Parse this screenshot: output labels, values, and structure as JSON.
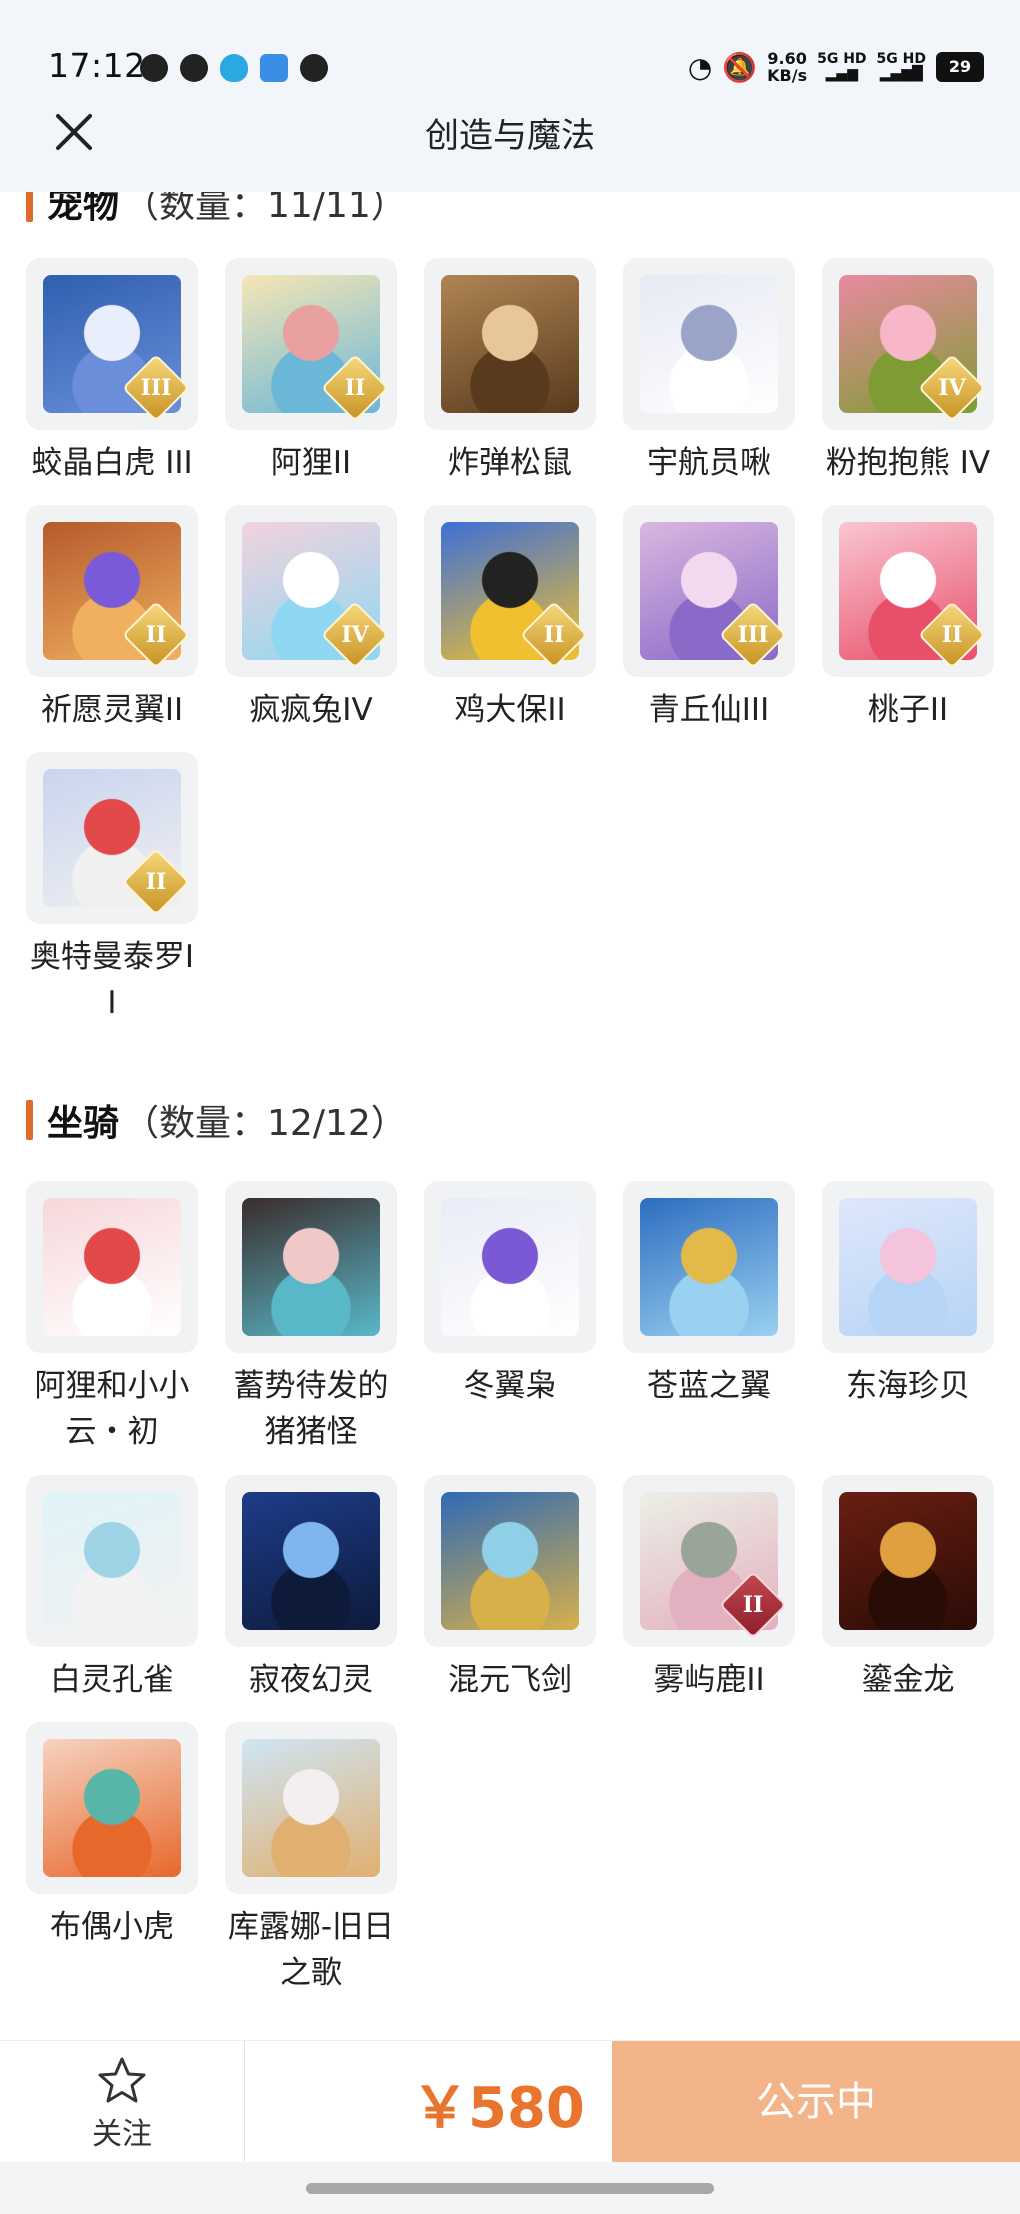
{
  "status_bar": {
    "time": "17:12",
    "net_speed": "9.60",
    "net_unit": "KB/s",
    "sig1": "5G HD",
    "sig2": "5G HD",
    "battery": "29"
  },
  "header": {
    "title": "创造与魔法"
  },
  "pets": {
    "title": "宠物",
    "count": "（数量：11/11）",
    "items": [
      {
        "label": "蛟晶白虎 III",
        "tier": "III",
        "badge": "gold"
      },
      {
        "label": "阿狸II",
        "tier": "II",
        "badge": "gold"
      },
      {
        "label": "炸弹松鼠",
        "tier": "",
        "badge": ""
      },
      {
        "label": "宇航员啾",
        "tier": "",
        "badge": ""
      },
      {
        "label": "粉抱抱熊 IV",
        "tier": "IV",
        "badge": "gold"
      },
      {
        "label": "祈愿灵翼II",
        "tier": "II",
        "badge": "gold"
      },
      {
        "label": "疯疯兔IV",
        "tier": "IV",
        "badge": "gold"
      },
      {
        "label": "鸡大保II",
        "tier": "II",
        "badge": "gold"
      },
      {
        "label": "青丘仙III",
        "tier": "III",
        "badge": "gold"
      },
      {
        "label": "桃子II",
        "tier": "II",
        "badge": "gold"
      },
      {
        "label": "奥特曼泰罗II",
        "tier": "II",
        "badge": "gold"
      }
    ]
  },
  "mounts": {
    "title": "坐骑",
    "count": "（数量：12/12）",
    "items": [
      {
        "label": "阿狸和小小云・初",
        "tier": "",
        "badge": ""
      },
      {
        "label": "蓄势待发的猪猪怪",
        "tier": "",
        "badge": ""
      },
      {
        "label": "冬翼枭",
        "tier": "",
        "badge": ""
      },
      {
        "label": "苍蓝之翼",
        "tier": "",
        "badge": ""
      },
      {
        "label": "东海珍贝",
        "tier": "",
        "badge": ""
      },
      {
        "label": "白灵孔雀",
        "tier": "",
        "badge": ""
      },
      {
        "label": "寂夜幻灵",
        "tier": "",
        "badge": ""
      },
      {
        "label": "混元飞剑",
        "tier": "",
        "badge": ""
      },
      {
        "label": "雾屿鹿II",
        "tier": "II",
        "badge": "red"
      },
      {
        "label": "鎏金龙",
        "tier": "",
        "badge": ""
      },
      {
        "label": "布偶小虎",
        "tier": "",
        "badge": ""
      },
      {
        "label": "库露娜-旧日之歌",
        "tier": "",
        "badge": ""
      }
    ]
  },
  "bottom": {
    "follow_label": "关注",
    "price": "￥580",
    "status_label": "公示中"
  },
  "colors": {
    "accent": "#e06a2b",
    "price": "#e8742e",
    "status_button": "#f2b488"
  }
}
